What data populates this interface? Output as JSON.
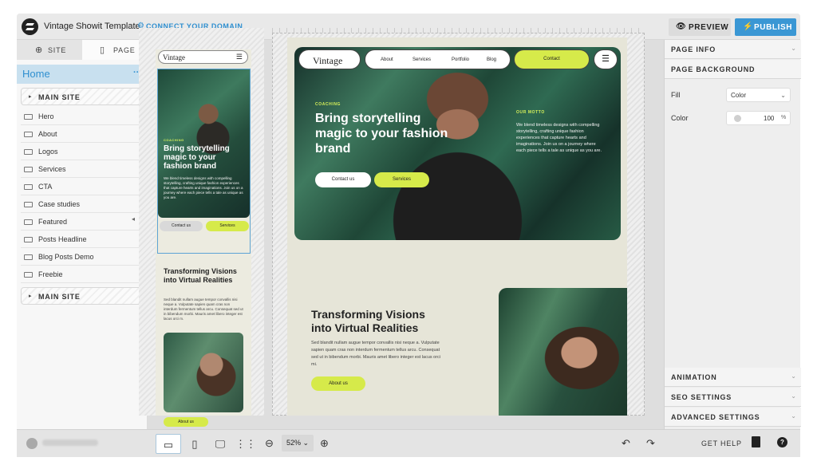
{
  "app": {
    "title": "Vintage Showit Template",
    "connect_domain": "CONNECT YOUR DOMAIN"
  },
  "topbar": {
    "preview": "PREVIEW",
    "publish": "PUBLISH"
  },
  "left_panel": {
    "tabs": [
      "SITE",
      "PAGE"
    ],
    "page_name": "Home",
    "more": "···",
    "main_site_1": "MAIN SITE",
    "main_site_2": "MAIN SITE",
    "sections": [
      "Hero",
      "About",
      "Logos",
      "Services",
      "CTA",
      "Case studies",
      "Featured",
      "Posts Headline",
      "Blog Posts Demo",
      "Freebie"
    ]
  },
  "mobile": {
    "brand": "Vintage",
    "eyebrow": "COACHING",
    "headline": "Bring storytelling magic to your fashion brand",
    "text": "We blend timeless designs with compelling storytelling, crafting unique fashion experiences that capture hearts and imaginations. Join us on a journey where each piece tells a tale as unique as you are.",
    "btn_contact": "Contact us",
    "btn_services": "Services",
    "h2": "Transforming Visions into Virtual Realities",
    "p2": "Sed blandit nullam augue tempor convallis nisi neque a. Vulputate sapien quam cras non interdum fermentum tellus arcu. Consequat sed ut in bibendum morbi. Mauris amet libero integer est lacus orci m.",
    "btn_about": "About us"
  },
  "desktop": {
    "brand": "Vintage",
    "nav": [
      "About",
      "Services",
      "Portfolio",
      "Blog"
    ],
    "contact": "Contact",
    "menu_icon": "☰",
    "eyebrow": "COACHING",
    "headline": "Bring storytelling magic to your fashion brand",
    "btn_contact": "Contact us",
    "btn_services": "Services",
    "motto_label": "OUR MOTTO",
    "motto_text": "We blend timeless designs with compelling storytelling, crafting unique fashion experiences that capture hearts and imaginations. Join us on a journey where each piece tells a tale as unique as you are.",
    "h2": "Transforming Visions into Virtual Realities",
    "p2": "Sed blandit nullam augue tempor convallis nisi neque a. Vulputate sapien quam cras non interdum fermentum tellus arcu. Consequat sed ut in bibendum morbi. Mauris amet libero integer est lacus orci mi.",
    "btn_about": "About us"
  },
  "right_panel": {
    "page_info": "PAGE INFO",
    "page_background": "PAGE BACKGROUND",
    "fill_label": "Fill",
    "fill_value": "Color",
    "color_label": "Color",
    "color_value": "100",
    "color_unit": "%",
    "animation": "ANIMATION",
    "seo": "SEO SETTINGS",
    "advanced": "ADVANCED SETTINGS"
  },
  "bottombar": {
    "zoom": "52% ⌄",
    "get_help": "GET HELP"
  },
  "colors": {
    "accent": "#3a97d4",
    "lime": "#d6ea4a",
    "page_bg": "#e6e5d8"
  }
}
